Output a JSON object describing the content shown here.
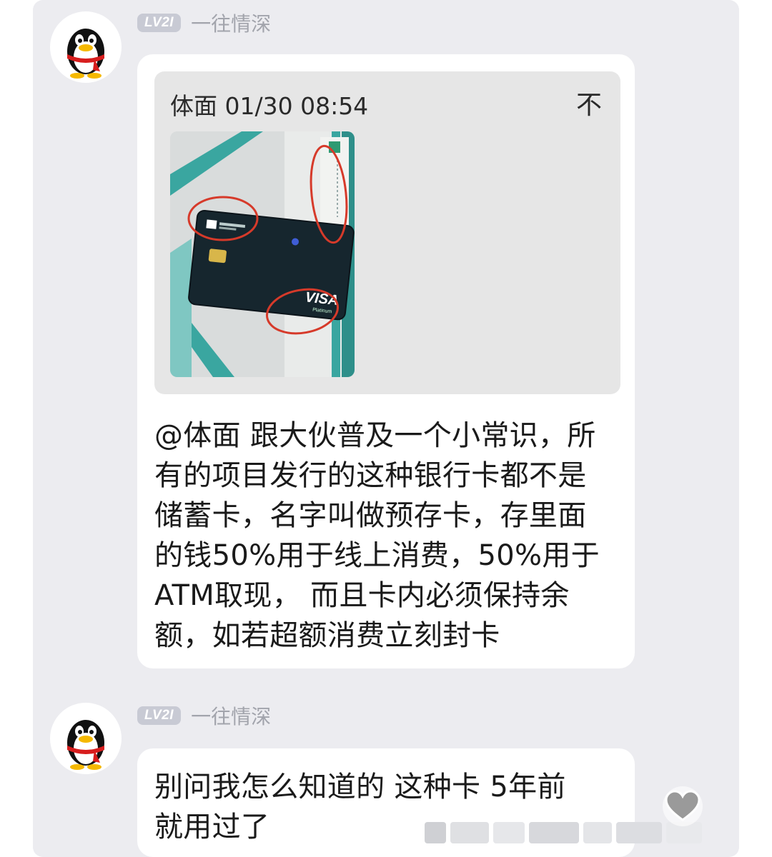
{
  "messages": [
    {
      "level": "LV2I",
      "username": "一往情深",
      "quote": {
        "header": "体面 01/30 08:54",
        "expand_glyph": "不"
      },
      "card": {
        "brand": "VISA",
        "brand_sub": "Platinum"
      },
      "text": "@体面 跟大伙普及一个小常识，所\n有的项目发行的这种银行卡都不是\n储蓄卡，名字叫做预存卡，存里面\n的钱50%用于线上消费，50%用于\nATM取现， 而且卡内必须保持余\n额，如若超额消费立刻封卡"
    },
    {
      "level": "LV2I",
      "username": "一往情深",
      "text": "别问我怎么知道的 这种卡 5年前\n就用过了"
    }
  ],
  "icons": {
    "avatar": "qq-penguin-icon",
    "like": "heart-icon"
  },
  "colors": {
    "panel": "#ececf0",
    "bubble": "#ffffff",
    "quote_box": "#e6e6e6",
    "badge": "#c8cad4",
    "username": "#a2a4ac",
    "annotation": "#d63a2a"
  }
}
